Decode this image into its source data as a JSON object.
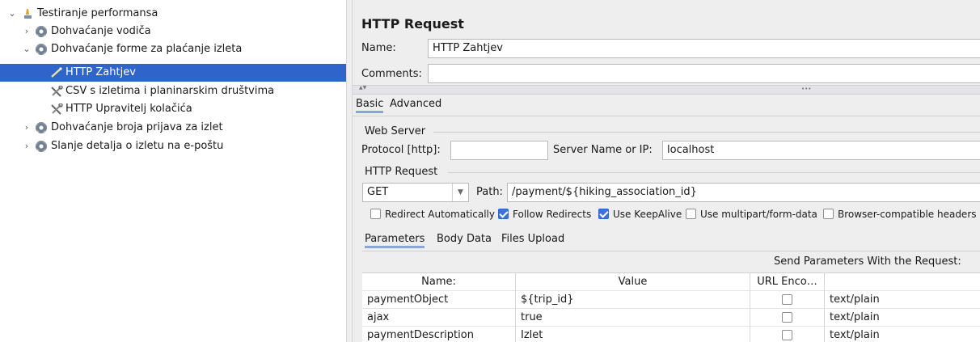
{
  "tree": {
    "items": [
      {
        "label": "Testiranje performansa",
        "icon": "test-plan-icon",
        "chevron": "⌄"
      },
      {
        "label": "Dohvaćanje vodiča",
        "icon": "gear-icon",
        "chevron": "›"
      },
      {
        "label": "Dohvaćanje forme za plaćanje izleta",
        "icon": "gear-icon",
        "chevron": "⌄"
      },
      {
        "label": "HTTP Zahtjev",
        "icon": "pipette-icon",
        "chevron": ""
      },
      {
        "label": "CSV s izletima i planinarskim društvima",
        "icon": "tools-icon",
        "chevron": ""
      },
      {
        "label": "HTTP Upravitelj kolačića",
        "icon": "tools-icon",
        "chevron": ""
      },
      {
        "label": "Dohvaćanje broja prijava za izlet",
        "icon": "gear-icon",
        "chevron": "›"
      },
      {
        "label": "Slanje detalja o izletu na e-poštu",
        "icon": "gear-icon",
        "chevron": "›"
      }
    ]
  },
  "panel": {
    "title": "HTTP Request",
    "name_label": "Name:",
    "name_value": "HTTP Zahtjev",
    "comments_label": "Comments:",
    "comments_value": "",
    "splitter_arrows": "▲▼",
    "splitter_dots": "•••",
    "tabs": {
      "basic": "Basic",
      "advanced": "Advanced"
    },
    "web_server": {
      "group_label": "Web Server",
      "protocol_label": "Protocol [http]:",
      "protocol_value": "",
      "server_label": "Server Name or IP:",
      "server_value": "localhost"
    },
    "http_request": {
      "group_label": "HTTP Request",
      "method": "GET",
      "path_label": "Path:",
      "path_value": "/payment/${hiking_association_id}"
    },
    "options": [
      {
        "label": "Redirect Automatically",
        "checked": false
      },
      {
        "label": "Follow Redirects",
        "checked": true
      },
      {
        "label": "Use KeepAlive",
        "checked": true
      },
      {
        "label": "Use multipart/form-data",
        "checked": false
      },
      {
        "label": "Browser-compatible headers",
        "checked": false
      }
    ],
    "subtabs": {
      "parameters": "Parameters",
      "body": "Body Data",
      "files": "Files Upload"
    },
    "send_params_label": "Send Parameters With the Request:",
    "table": {
      "headers": [
        "Name:",
        "Value",
        "URL Enco…",
        ""
      ],
      "rows": [
        {
          "name": "paymentObject",
          "value": "${trip_id}",
          "encode": false,
          "content_type": "text/plain"
        },
        {
          "name": "ajax",
          "value": "true",
          "encode": false,
          "content_type": "text/plain"
        },
        {
          "name": "paymentDescription",
          "value": "Izlet",
          "encode": false,
          "content_type": "text/plain"
        }
      ]
    }
  },
  "colors": {
    "selection": "#2f65ca",
    "panel_bg": "#eeeeef",
    "checkbox_on": "#3b74d8"
  }
}
